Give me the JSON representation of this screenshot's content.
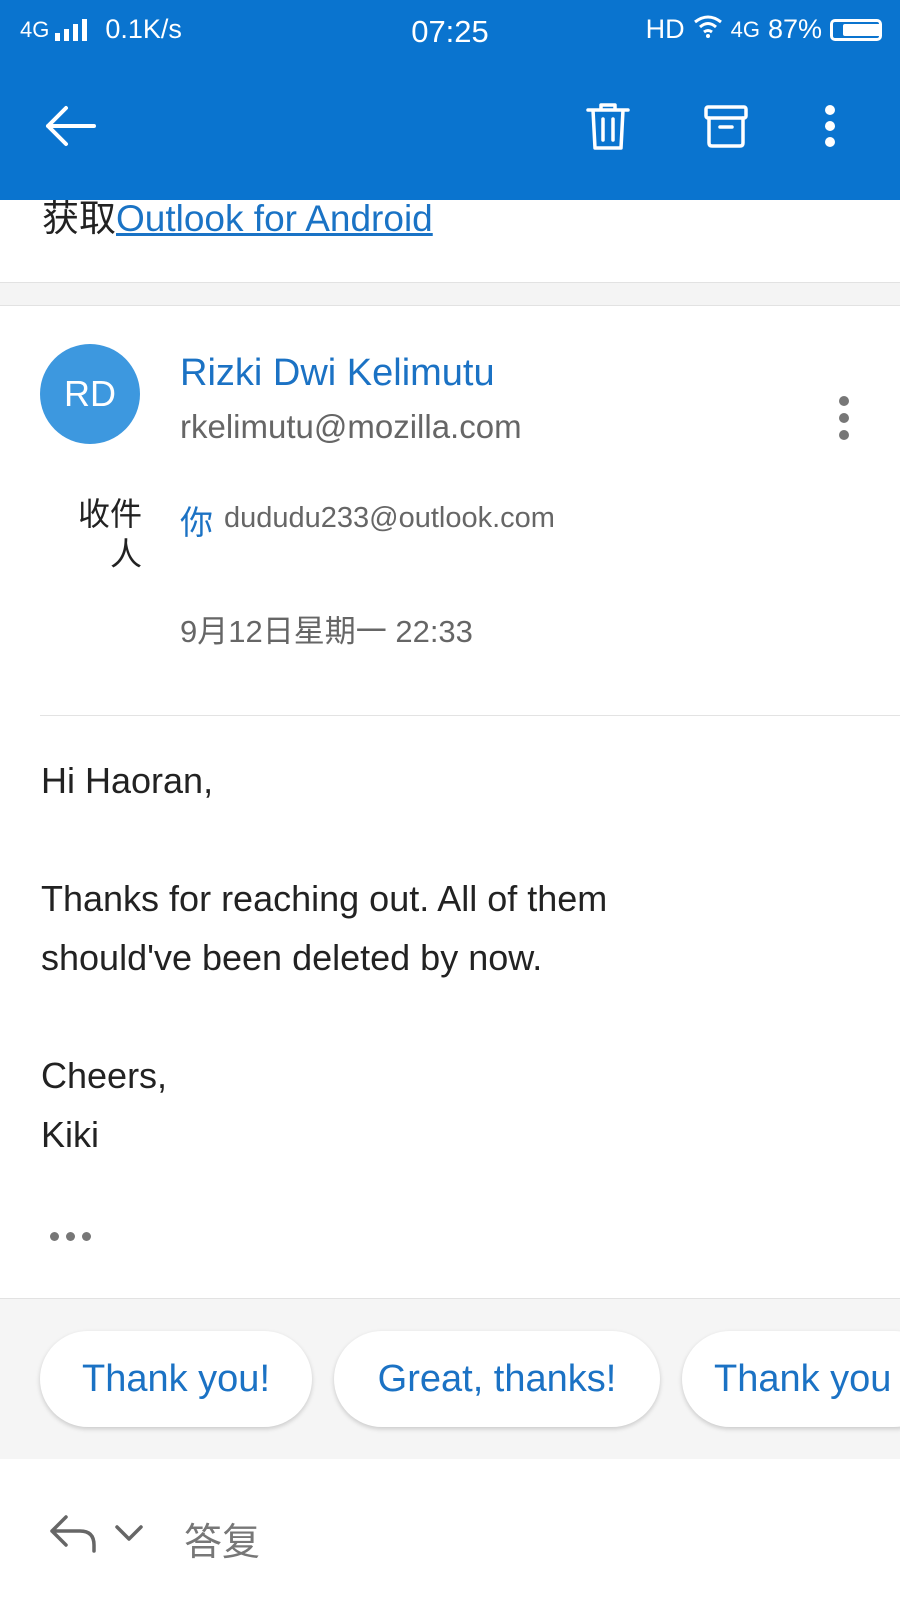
{
  "status_bar": {
    "network": "4G",
    "speed": "0.1K/s",
    "time": "07:25",
    "hd": "HD",
    "network_right": "4G",
    "battery": "87%"
  },
  "toolbar": {
    "back_icon": "back-arrow-icon",
    "delete_icon": "trash-icon",
    "archive_icon": "archive-icon",
    "more_icon": "more-vertical-icon"
  },
  "promo": {
    "prefix": "获取",
    "link": "Outlook for Android"
  },
  "message": {
    "avatar_initials": "RD",
    "avatar_color": "#3d98df",
    "sender_name": "Rizki Dwi Kelimutu",
    "sender_email": "rkelimutu@mozilla.com",
    "to_label": "收件人",
    "to_you": "你",
    "to_email": "dududu233@outlook.com",
    "date": "9月12日星期一 22:33",
    "body": [
      "Hi Haoran,",
      "Thanks for reaching out. All of them",
      "should've been deleted by now.",
      "Cheers,",
      "Kiki"
    ]
  },
  "quick_replies": [
    "Thank you!",
    "Great, thanks!",
    "Thank you"
  ],
  "reply_bar": {
    "placeholder": "答复"
  },
  "colors": {
    "brand_blue": "#0a74cf",
    "link_blue": "#1b72c4"
  }
}
